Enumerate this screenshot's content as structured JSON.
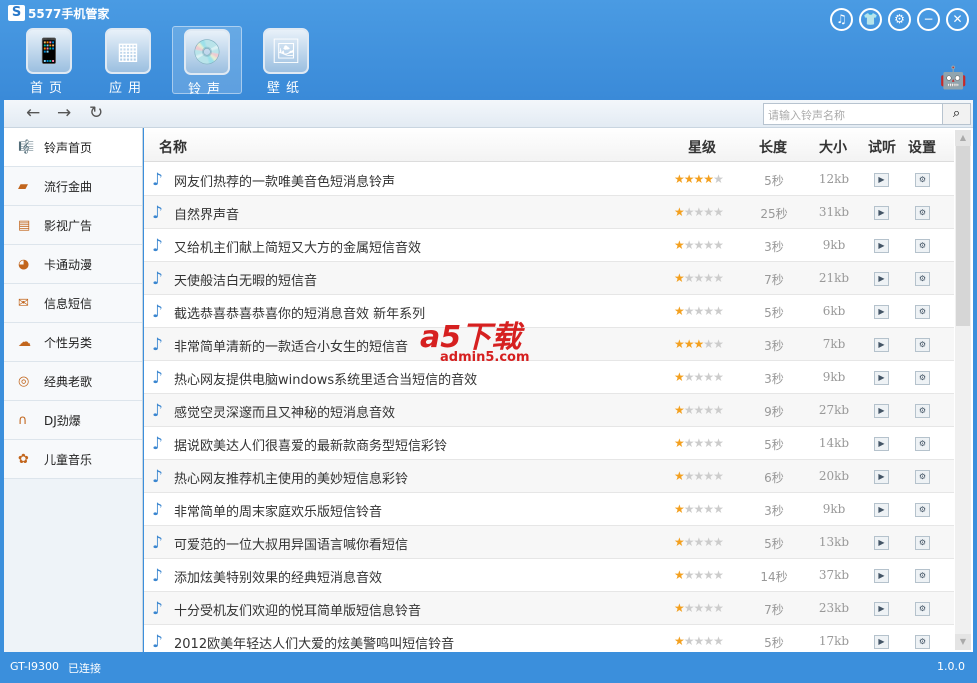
{
  "app": {
    "title": "5577手机管家",
    "logo": "S",
    "version": "1.0.0",
    "device": "GT-I9300",
    "status": "已连接"
  },
  "nav": [
    {
      "label": "首页",
      "icon": "phone-icon",
      "glyph": "📱"
    },
    {
      "label": "应用",
      "icon": "apps-icon",
      "glyph": "▦"
    },
    {
      "label": "铃声",
      "icon": "cd-icon",
      "glyph": "💿"
    },
    {
      "label": "壁纸",
      "icon": "wallpaper-icon",
      "glyph": "🖼"
    }
  ],
  "window_buttons": [
    {
      "name": "music",
      "glyph": "♫"
    },
    {
      "name": "skin",
      "glyph": "👕"
    },
    {
      "name": "settings",
      "glyph": "⚙"
    },
    {
      "name": "minimize",
      "glyph": "−"
    },
    {
      "name": "close",
      "glyph": "✕"
    }
  ],
  "toolbar": {
    "back": "←",
    "forward": "→",
    "refresh": "↻",
    "search_placeholder": "请输入铃声名称",
    "search_glyph": "⌕"
  },
  "sidebar": [
    {
      "label": "铃声首页",
      "glyph": "🎼"
    },
    {
      "label": "流行金曲",
      "glyph": "▰"
    },
    {
      "label": "影视广告",
      "glyph": "▤"
    },
    {
      "label": "卡通动漫",
      "glyph": "◕"
    },
    {
      "label": "信息短信",
      "glyph": "✉"
    },
    {
      "label": "个性另类",
      "glyph": "☁"
    },
    {
      "label": "经典老歌",
      "glyph": "◎"
    },
    {
      "label": "DJ劲爆",
      "glyph": "∩"
    },
    {
      "label": "儿童音乐",
      "glyph": "✿"
    }
  ],
  "table": {
    "headers": {
      "name": "名称",
      "rating": "星级",
      "length": "长度",
      "size": "大小",
      "listen": "试听",
      "settings": "设置"
    },
    "rows": [
      {
        "name": "网友们热荐的一款唯美音色短消息铃声",
        "stars": 4,
        "length": "5秒",
        "size": "12kb"
      },
      {
        "name": "自然界声音",
        "stars": 1,
        "length": "25秒",
        "size": "31kb"
      },
      {
        "name": "又给机主们献上简短又大方的金属短信音效",
        "stars": 1,
        "length": "3秒",
        "size": "9kb"
      },
      {
        "name": "天使般洁白无暇的短信音",
        "stars": 1,
        "length": "7秒",
        "size": "21kb"
      },
      {
        "name": "截选恭喜恭喜恭喜你的短消息音效 新年系列",
        "stars": 1,
        "length": "5秒",
        "size": "6kb"
      },
      {
        "name": "非常简单清新的一款适合小女生的短信音",
        "stars": 3,
        "length": "3秒",
        "size": "7kb"
      },
      {
        "name": "热心网友提供电脑windows系统里适合当短信的音效",
        "stars": 1,
        "length": "3秒",
        "size": "9kb"
      },
      {
        "name": "感觉空灵深邃而且又神秘的短消息音效",
        "stars": 1,
        "length": "9秒",
        "size": "27kb"
      },
      {
        "name": "据说欧美达人们很喜爱的最新款商务型短信彩铃",
        "stars": 1,
        "length": "5秒",
        "size": "14kb"
      },
      {
        "name": "热心网友推荐机主使用的美妙短信息彩铃",
        "stars": 1,
        "length": "6秒",
        "size": "20kb"
      },
      {
        "name": "非常简单的周末家庭欢乐版短信铃音",
        "stars": 1,
        "length": "3秒",
        "size": "9kb"
      },
      {
        "name": "可爱范的一位大叔用异国语言喊你看短信",
        "stars": 1,
        "length": "5秒",
        "size": "13kb"
      },
      {
        "name": "添加炫美特别效果的经典短消息音效",
        "stars": 1,
        "length": "14秒",
        "size": "37kb"
      },
      {
        "name": "十分受机友们欢迎的悦耳简单版短信息铃音",
        "stars": 1,
        "length": "7秒",
        "size": "23kb"
      },
      {
        "name": "2012欧美年轻达人们大爱的炫美警鸣叫短信铃音",
        "stars": 1,
        "length": "5秒",
        "size": "17kb"
      }
    ]
  },
  "watermark": {
    "text": "a5下载",
    "sub": "admin5.com"
  }
}
